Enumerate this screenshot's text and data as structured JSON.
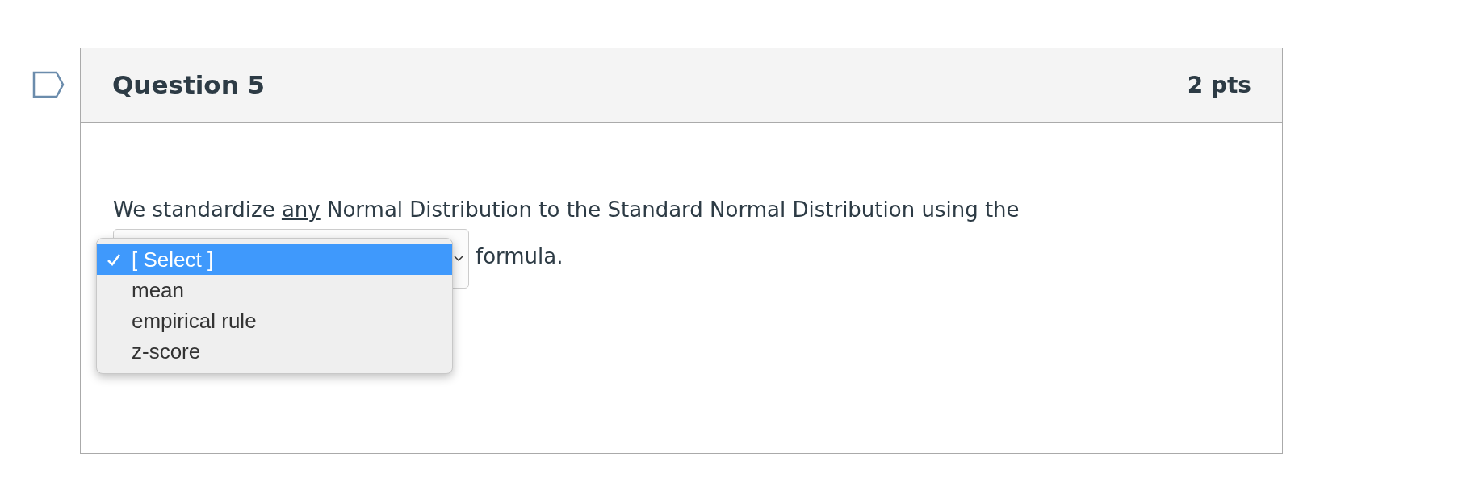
{
  "question": {
    "title": "Question 5",
    "points": "2 pts",
    "prompt_before": "We standardize ",
    "prompt_underlined": "any",
    "prompt_after": " Normal Distribution to the Standard Normal Distribution using the",
    "after_select": "formula.",
    "dropdown": {
      "expanded": true,
      "options": [
        {
          "label": "[ Select ]",
          "selected": true
        },
        {
          "label": "mean",
          "selected": false
        },
        {
          "label": "empirical rule",
          "selected": false
        },
        {
          "label": "z-score",
          "selected": false
        }
      ]
    }
  }
}
